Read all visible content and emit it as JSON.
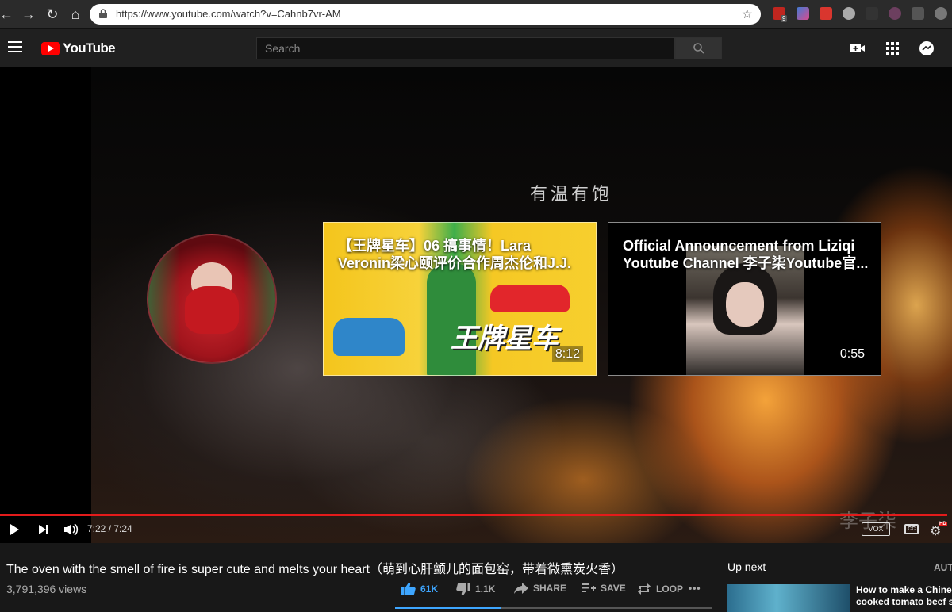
{
  "browser": {
    "url": "https://www.youtube.com/watch?v=Cahnb7vr-AM",
    "extension_badge": "9"
  },
  "masthead": {
    "logo_text": "YouTube",
    "search_placeholder": "Search"
  },
  "player": {
    "overlay_text": "有温有饱",
    "watermark": "李子柒",
    "time_display": "7:22 / 7:24",
    "progress_fraction": 0.995,
    "vox_label": "VOX",
    "cc_label": "CC",
    "hd_label": "HD"
  },
  "endcards": [
    {
      "title": "【王牌星车】06 搞事情！Lara Veronin梁心颐评价合作周杰伦和J.J.",
      "brand_text": "王牌星车",
      "duration": "8:12"
    },
    {
      "title": "Official Announcement from Liziqi Youtube Channel 李子柒Youtube官...",
      "duration": "0:55"
    }
  ],
  "video": {
    "title": "The oven with the smell of fire is super cute and melts your heart（萌到心肝颤儿的面包窑，带着微熏炭火香）",
    "views": "3,791,396 views",
    "likes": "61K",
    "dislikes": "1.1K",
    "share_label": "SHARE",
    "save_label": "SAVE",
    "loop_label": "LOOP",
    "more_label": "•••"
  },
  "sidebar": {
    "upnext_label": "Up next",
    "autoplay_label": "AUT",
    "next_video_title_line1": "How to make a Chine",
    "next_video_title_line2": "cooked tomato beef s"
  },
  "colors": {
    "brand_red": "#ff0000",
    "progress_red": "#e31b1b",
    "like_blue": "#3ea6ff"
  }
}
